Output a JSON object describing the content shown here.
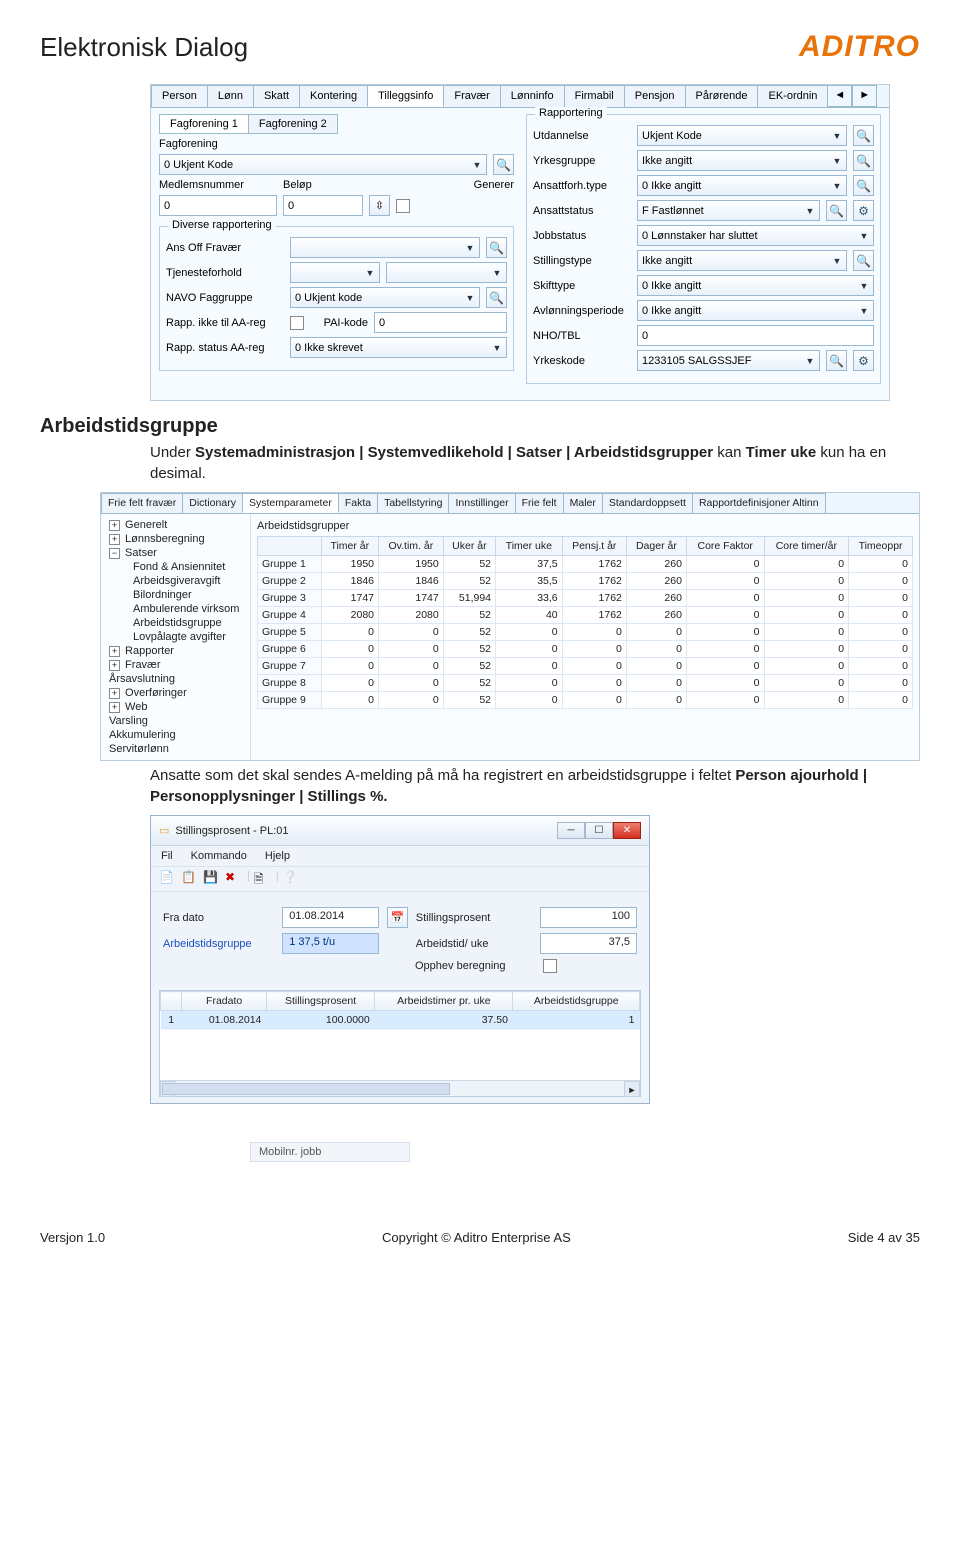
{
  "doc": {
    "title": "Elektronisk Dialog",
    "logo": "ADITRO"
  },
  "section1": {
    "heading": "Arbeidstidsgruppe",
    "p1_a": "Under ",
    "p1_b": "Systemadministrasjon | Systemvedlikehold | Satser | Arbeidstidsgrupper",
    "p1_c": " kan ",
    "p1_d": "Timer uke",
    "p1_e": " kun ha en desimal.",
    "p2_a": "Ansatte som det skal sendes A-melding på må ha registrert en arbeidstidsgruppe i feltet ",
    "p2_b": "Person ajourhold | Personopplysninger | Stillings %.",
    "p2_c": ""
  },
  "shot1": {
    "tabs": [
      "Person",
      "Lønn",
      "Skatt",
      "Kontering",
      "Tilleggsinfo",
      "Fravær",
      "Lønninfo",
      "Firmabil",
      "Pensjon",
      "Pårørende",
      "EK-ordnin"
    ],
    "activeTab": "Tilleggsinfo",
    "left": {
      "subtabs": [
        "Fagforening 1",
        "Fagforening 2"
      ],
      "fagforening_label": "Fagforening",
      "fagforening_value": "0 Ukjent Kode",
      "medlemsnummer_label": "Medlemsnummer",
      "medlemsnummer_value": "0",
      "belop_label": "Beløp",
      "belop_value": "0",
      "generer_label": "Generer",
      "diverse_legend": "Diverse rapportering",
      "ans_off_label": "Ans Off Fravær",
      "tjeneste_label": "Tjenesteforhold",
      "navo_label": "NAVO Faggruppe",
      "navo_value": "0 Ukjent kode",
      "rapp_ikke_label": "Rapp. ikke til AA-reg",
      "pai_label": "PAI-kode",
      "pai_value": "0",
      "rapp_status_label": "Rapp. status AA-reg",
      "rapp_status_value": "0 Ikke skrevet"
    },
    "right": {
      "legend": "Rapportering",
      "rows": [
        {
          "label": "Utdannelse",
          "value": "Ukjent Kode",
          "mag": true
        },
        {
          "label": "Yrkesgruppe",
          "value": "Ikke angitt",
          "mag": true
        },
        {
          "label": "Ansattforh.type",
          "value": "0 Ikke angitt",
          "mag": true
        },
        {
          "label": "Ansattstatus",
          "value": "F Fastlønnet",
          "mag": true,
          "extra": true
        },
        {
          "label": "Jobbstatus",
          "value": "0 Lønnstaker har sluttet",
          "mag": false
        },
        {
          "label": "Stillingstype",
          "value": "Ikke angitt",
          "mag": true
        },
        {
          "label": "Skifttype",
          "value": "0 Ikke angitt",
          "mag": false
        },
        {
          "label": "Avlønningsperiode",
          "value": "0 Ikke angitt",
          "mag": false
        },
        {
          "label": "NHO/TBL",
          "value": "0",
          "mag": false,
          "numeric": true
        },
        {
          "label": "Yrkeskode",
          "value": "1233105 SALGSSJEF",
          "mag": true,
          "extra": true
        }
      ]
    }
  },
  "shot2": {
    "tabs": [
      "Frie felt fravær",
      "Dictionary",
      "Systemparameter",
      "Fakta",
      "Tabellstyring",
      "Innstillinger",
      "Frie felt",
      "Maler",
      "Standardoppsett",
      "Rapportdefinisjoner Altinn"
    ],
    "activeTab": "Systemparameter",
    "tree": [
      {
        "txt": "Generelt",
        "lvl": 0,
        "sym": "+"
      },
      {
        "txt": "Lønnsberegning",
        "lvl": 0,
        "sym": "+"
      },
      {
        "txt": "Satser",
        "lvl": 0,
        "sym": "−"
      },
      {
        "txt": "Fond & Ansiennitet",
        "lvl": 2
      },
      {
        "txt": "Arbeidsgiveravgift",
        "lvl": 2
      },
      {
        "txt": "Bilordninger",
        "lvl": 2
      },
      {
        "txt": "Ambulerende virksom",
        "lvl": 2
      },
      {
        "txt": "Arbeidstidsgruppe",
        "lvl": 2
      },
      {
        "txt": "Lovpålagte avgifter",
        "lvl": 2
      },
      {
        "txt": "Rapporter",
        "lvl": 0,
        "sym": "+"
      },
      {
        "txt": "Fravær",
        "lvl": 0,
        "sym": "+"
      },
      {
        "txt": "Årsavslutning",
        "lvl": 0
      },
      {
        "txt": "Overføringer",
        "lvl": 0,
        "sym": "+"
      },
      {
        "txt": "Web",
        "lvl": 0,
        "sym": "+"
      },
      {
        "txt": "Varsling",
        "lvl": 0
      },
      {
        "txt": "Akkumulering",
        "lvl": 0
      },
      {
        "txt": "Servitørlønn",
        "lvl": 0
      }
    ],
    "grid_title": "Arbeidstidsgrupper",
    "columns": [
      "",
      "Timer år",
      "Ov.tim. år",
      "Uker år",
      "Timer uke",
      "Pensj.t år",
      "Dager år",
      "Core Faktor",
      "Core timer/år",
      "Timeoppr"
    ],
    "rows": [
      [
        "Gruppe 1",
        "1950",
        "1950",
        "52",
        "37,5",
        "1762",
        "260",
        "0",
        "0",
        "0"
      ],
      [
        "Gruppe 2",
        "1846",
        "1846",
        "52",
        "35,5",
        "1762",
        "260",
        "0",
        "0",
        "0"
      ],
      [
        "Gruppe 3",
        "1747",
        "1747",
        "51,994",
        "33,6",
        "1762",
        "260",
        "0",
        "0",
        "0"
      ],
      [
        "Gruppe 4",
        "2080",
        "2080",
        "52",
        "40",
        "1762",
        "260",
        "0",
        "0",
        "0"
      ],
      [
        "Gruppe 5",
        "0",
        "0",
        "52",
        "0",
        "0",
        "0",
        "0",
        "0",
        "0"
      ],
      [
        "Gruppe 6",
        "0",
        "0",
        "52",
        "0",
        "0",
        "0",
        "0",
        "0",
        "0"
      ],
      [
        "Gruppe 7",
        "0",
        "0",
        "52",
        "0",
        "0",
        "0",
        "0",
        "0",
        "0"
      ],
      [
        "Gruppe 8",
        "0",
        "0",
        "52",
        "0",
        "0",
        "0",
        "0",
        "0",
        "0"
      ],
      [
        "Gruppe 9",
        "0",
        "0",
        "52",
        "0",
        "0",
        "0",
        "0",
        "0",
        "0"
      ]
    ]
  },
  "shot3": {
    "title": "Stillingsprosent - PL:01",
    "menu": [
      "Fil",
      "Kommando",
      "Hjelp"
    ],
    "fra_dato_label": "Fra dato",
    "fra_dato_value": "01.08.2014",
    "stillingsprosent_label": "Stillingsprosent",
    "stillingsprosent_value": "100",
    "arbeidstidsgruppe_label": "Arbeidstidsgruppe",
    "arbeidstidsgruppe_value": "1 37,5 t/u",
    "arbeidstid_uke_label": "Arbeidstid/ uke",
    "arbeidstid_uke_value": "37,5",
    "opphev_label": "Opphev beregning",
    "list_headers": [
      "",
      "Fradato",
      "Stillingsprosent",
      "Arbeidstimer pr. uke",
      "Arbeidstidsgruppe"
    ],
    "list_row": [
      "1",
      "01.08.2014",
      "100.0000",
      "37.50",
      "1"
    ]
  },
  "stray": "Mobilnr. jobb",
  "footer": {
    "version": "Versjon 1.0",
    "copyright": "Copyright © Aditro Enterprise AS",
    "page": "Side 4 av 35"
  }
}
